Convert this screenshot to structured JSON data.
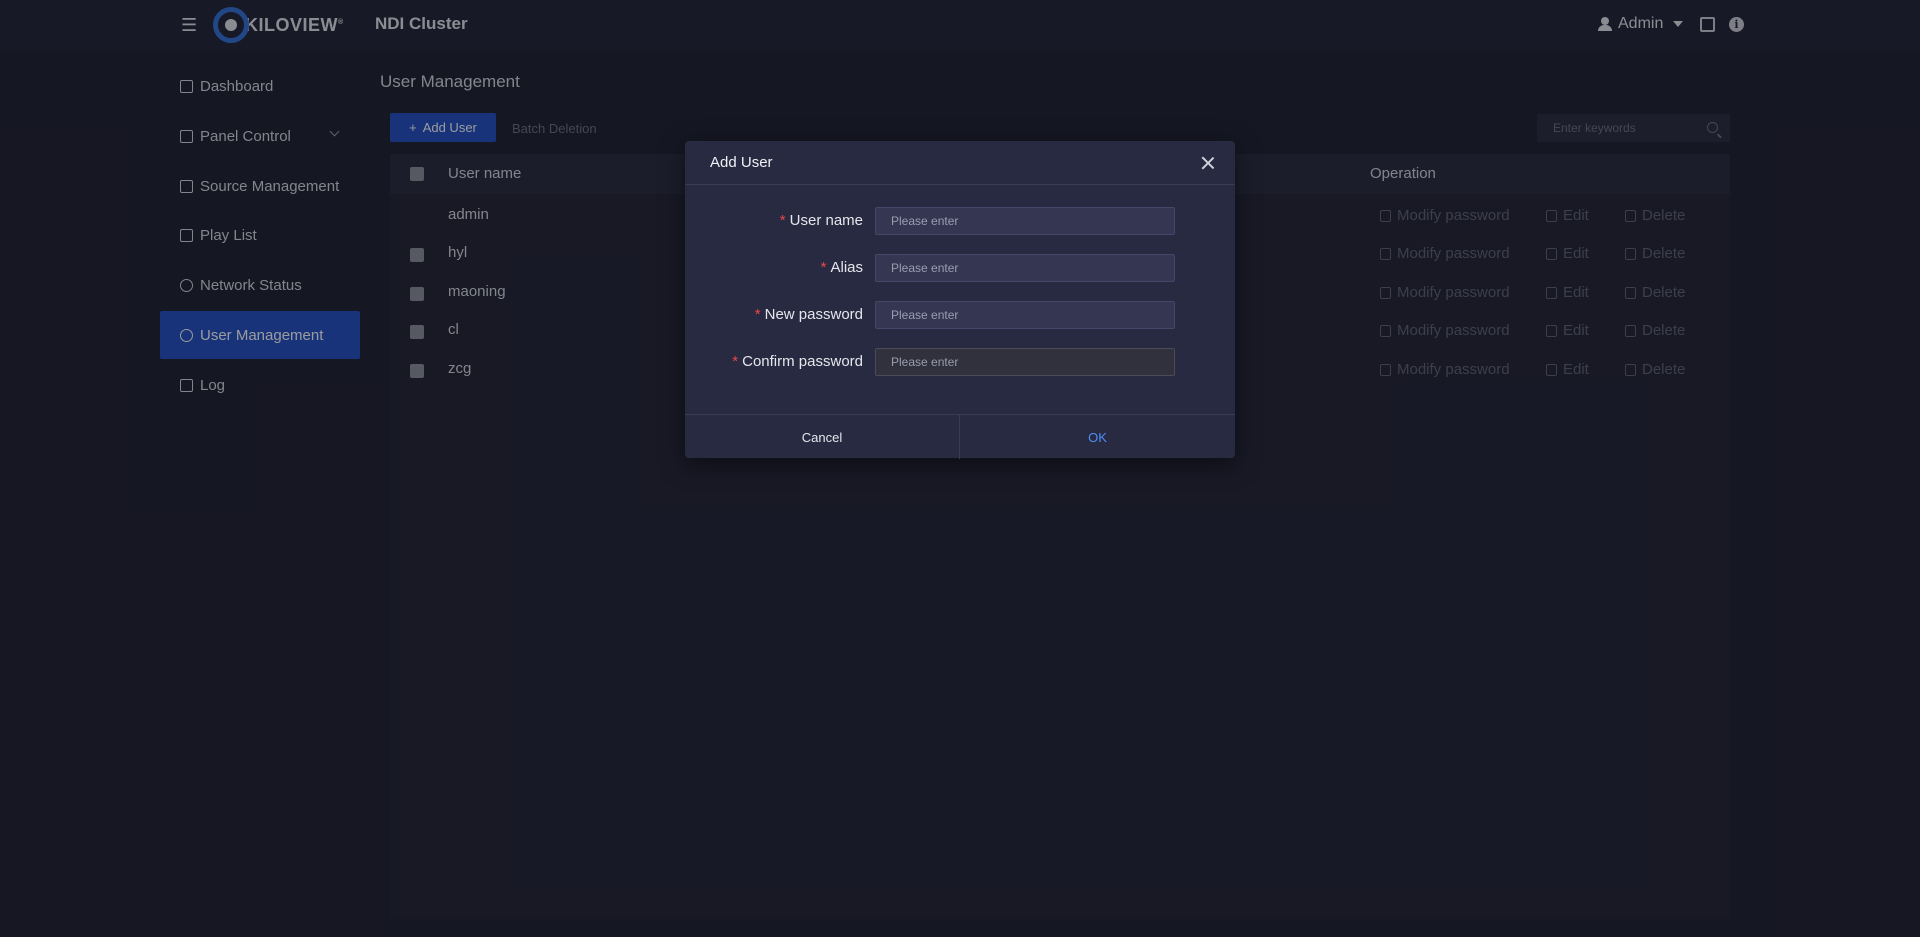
{
  "header": {
    "brand": "KILOVIEW",
    "brand_mark": "®",
    "app_title": "NDI Cluster",
    "user": "Admin"
  },
  "sidebar": {
    "items": [
      {
        "label": "Dashboard",
        "icon": "dashboard-icon"
      },
      {
        "label": "Panel Control",
        "icon": "panel-control-icon"
      },
      {
        "label": "Source Management",
        "icon": "source-icon"
      },
      {
        "label": "Play List",
        "icon": "playlist-icon"
      },
      {
        "label": "Network Status",
        "icon": "globe-icon"
      },
      {
        "label": "User Management",
        "icon": "user-icon",
        "active": true
      },
      {
        "label": "Log",
        "icon": "log-icon"
      }
    ]
  },
  "page": {
    "title": "User Management",
    "add_user": "Add User",
    "batch_deletion": "Batch Deletion",
    "search_placeholder": "Enter keywords"
  },
  "table": {
    "columns": {
      "username": "User name",
      "operation": "Operation"
    },
    "rows": [
      {
        "username": "admin",
        "checkbox": false
      },
      {
        "username": "hyl",
        "checkbox": true
      },
      {
        "username": "maoning",
        "checkbox": true
      },
      {
        "username": "cl",
        "checkbox": true
      },
      {
        "username": "zcg",
        "checkbox": true
      }
    ],
    "actions": {
      "modify_password": "Modify password",
      "edit": "Edit",
      "delete": "Delete"
    }
  },
  "modal": {
    "title": "Add User",
    "fields": [
      {
        "label": "User name",
        "placeholder": "Please enter",
        "required": "*"
      },
      {
        "label": "Alias",
        "placeholder": "Please enter",
        "required": "*"
      },
      {
        "label": "New password",
        "placeholder": "Please enter",
        "required": "*"
      },
      {
        "label": "Confirm password",
        "placeholder": "Please enter",
        "required": "*"
      }
    ],
    "cancel": "Cancel",
    "ok": "OK"
  },
  "colors": {
    "accent": "#1f4cc2",
    "ok": "#4c8ef7",
    "required": "#e8484a"
  }
}
